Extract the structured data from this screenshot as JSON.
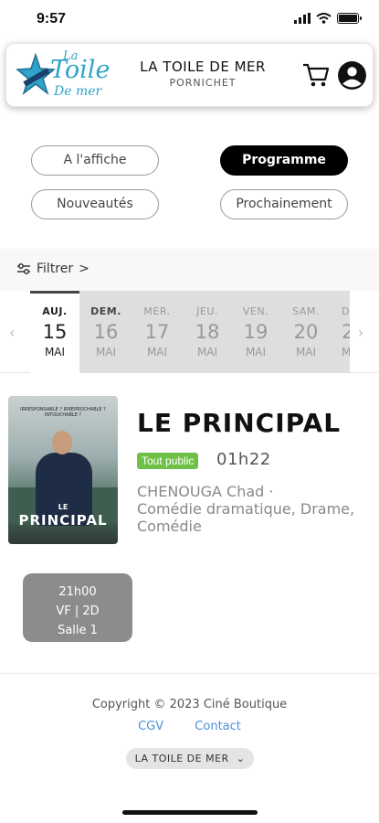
{
  "status_bar": {
    "time": "9:57"
  },
  "header": {
    "logo": {
      "la": "La",
      "toile": "Toile",
      "demer": "De mer"
    },
    "cinema_name": "LA TOILE DE MER",
    "city": "PORNICHET"
  },
  "nav": {
    "a_laffiche": "A l'affiche",
    "programme": "Programme",
    "nouveautes": "Nouveautés",
    "prochainement": "Prochainement"
  },
  "filter": {
    "label": "Filtrer",
    "chevron": ">"
  },
  "dates": {
    "prev_arrow": "‹",
    "next_arrow": "›",
    "items": [
      {
        "day": "AUJ.",
        "num": "15",
        "month": "MAI"
      },
      {
        "day": "DEM.",
        "num": "16",
        "month": "MAI"
      },
      {
        "day": "MER.",
        "num": "17",
        "month": "MAI"
      },
      {
        "day": "JEU.",
        "num": "18",
        "month": "MAI"
      },
      {
        "day": "VEN.",
        "num": "19",
        "month": "MAI"
      },
      {
        "day": "SAM.",
        "num": "20",
        "month": "MAI"
      },
      {
        "day": "D",
        "num": "2",
        "month": "M"
      }
    ]
  },
  "movie": {
    "poster": {
      "tagline": "IRRESPONSABLE ? IRREPROCHABLE ? INTOUCHABLE ?",
      "title_le": "LE",
      "title": "PRINCIPAL"
    },
    "title": "LE PRINCIPAL",
    "rating_badge": "Tout public",
    "duration": "01h22",
    "director": "CHENOUGA Chad",
    "separator": "·",
    "genres": "Comédie dramatique, Drame, Comédie",
    "showtime": {
      "time": "21h00",
      "version": "VF | 2D",
      "room": "Salle 1"
    }
  },
  "footer": {
    "copyright": "Copyright © 2023 Ciné Boutique",
    "cgv": "CGV",
    "contact": "Contact",
    "cinema_select": "LA TOILE DE MER",
    "select_chevron": "⌄"
  }
}
